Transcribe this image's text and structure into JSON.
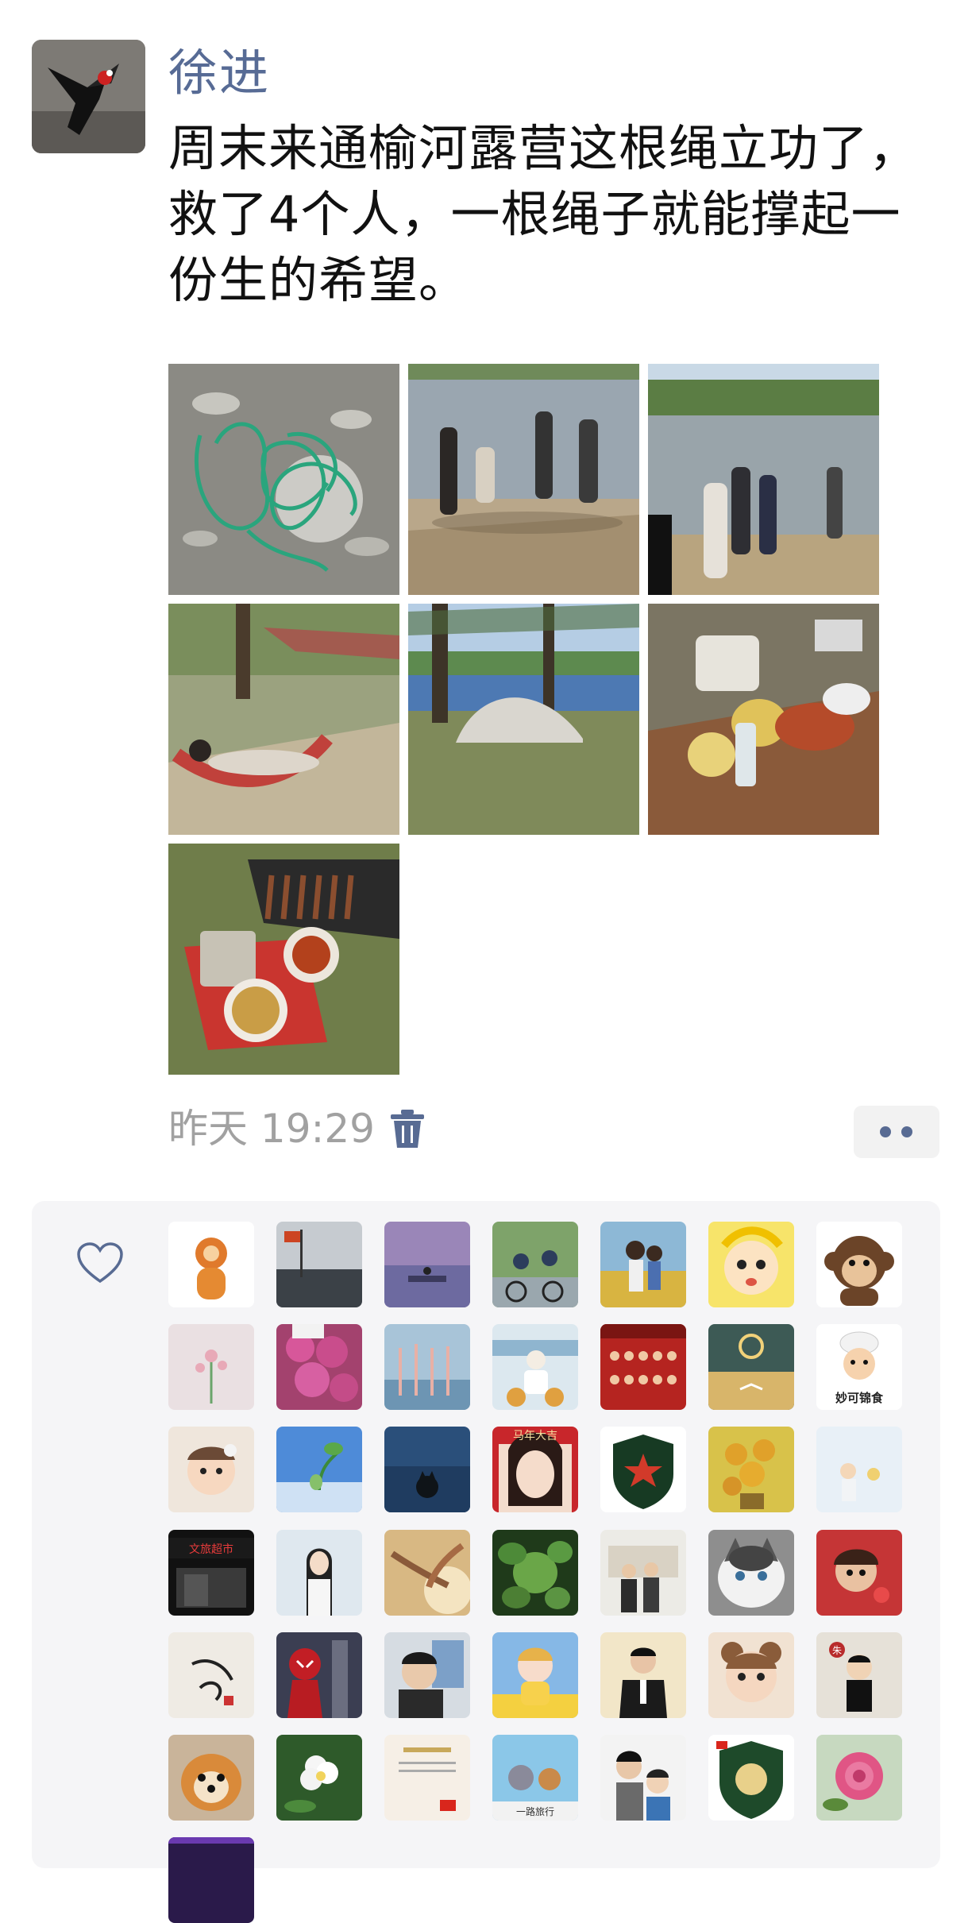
{
  "post": {
    "author": "徐进",
    "text": "周末来通榆河露营这根绳立功了，救了4个人，一根绳子就能撑起一份生的希望。",
    "time": "昨天 19:29",
    "photos": [
      {
        "name": "photo-rope"
      },
      {
        "name": "photo-river-rescue-1"
      },
      {
        "name": "photo-river-rescue-2"
      },
      {
        "name": "photo-hammock"
      },
      {
        "name": "photo-tent"
      },
      {
        "name": "photo-food-table"
      },
      {
        "name": "photo-barbecue"
      }
    ]
  },
  "likes": {
    "icon": "heart-icon",
    "avatar_texts": {
      "a13": "妙可锦食",
      "a17": "马年大吉",
      "a22": "文旅超市",
      "a26": "朱",
      "a29": "一路旅行"
    }
  },
  "colors": {
    "name_link": "#576b95",
    "meta_gray": "#a1a1a1",
    "panel_bg": "#f5f5f7"
  }
}
